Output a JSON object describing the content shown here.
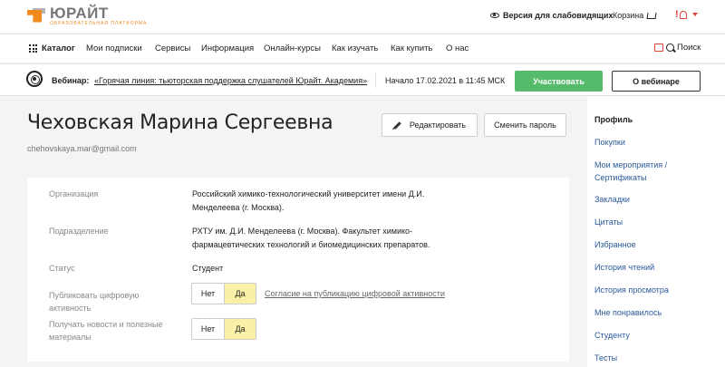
{
  "header": {
    "logo_name": "ЮРАЙТ",
    "logo_sub": "образовательная платформа",
    "visually_impaired": "Версия для слабовидящих",
    "cart": "Корзина",
    "user_glyph": "!"
  },
  "nav": {
    "items": [
      "Каталог",
      "Мои подписки",
      "Сервисы",
      "Информация",
      "Онлайн-курсы",
      "Как изучать",
      "Как купить",
      "О нас"
    ],
    "search": "Поиск"
  },
  "webinar": {
    "label": "Вебинар:",
    "title": "«Горячая линия: тьюторская поддержка слушателей Юрайт. Академия»",
    "time": "Начало 17.02.2021 в 11:45 МСК",
    "join": "Участвовать",
    "about": "О вебинаре"
  },
  "profile": {
    "name": "Чеховская Марина Сергеевна",
    "email": "chehovskaya.mar@gmail.com",
    "edit": "Редактировать",
    "change_password": "Сменить пароль",
    "rows": [
      {
        "label": "Организация",
        "value": "Российский химико-технологический университет имени Д.И. Менделеева (г. Москва)."
      },
      {
        "label": "Подразделение",
        "value": "РХТУ им. Д.И. Менделеева (г. Москва). Факультет химико-фармацевтических технологий и биомедицинских препаратов."
      },
      {
        "label": "Статус",
        "value": "Студент"
      },
      {
        "label": "Публиковать цифровую активность",
        "no": "Нет",
        "yes": "Да",
        "link": "Согласие на публикацию цифровой активности"
      },
      {
        "label": "Получать новости и полезные материалы",
        "no": "Нет",
        "yes": "Да"
      }
    ]
  },
  "sidebar": {
    "items": [
      "Профиль",
      "Покупки",
      "Мои мероприятия / Сертификаты",
      "Закладки",
      "Цитаты",
      "Избранное",
      "История чтений",
      "История просмотра",
      "Мне понравилось",
      "Студенту",
      "Тесты"
    ]
  },
  "colors": {
    "accent_orange": "#f08a1e",
    "join_green": "#57bb6c",
    "toggle_yellow": "#fbf0a8",
    "link_blue": "#2a5a9a",
    "alert_red": "#e0403a"
  }
}
